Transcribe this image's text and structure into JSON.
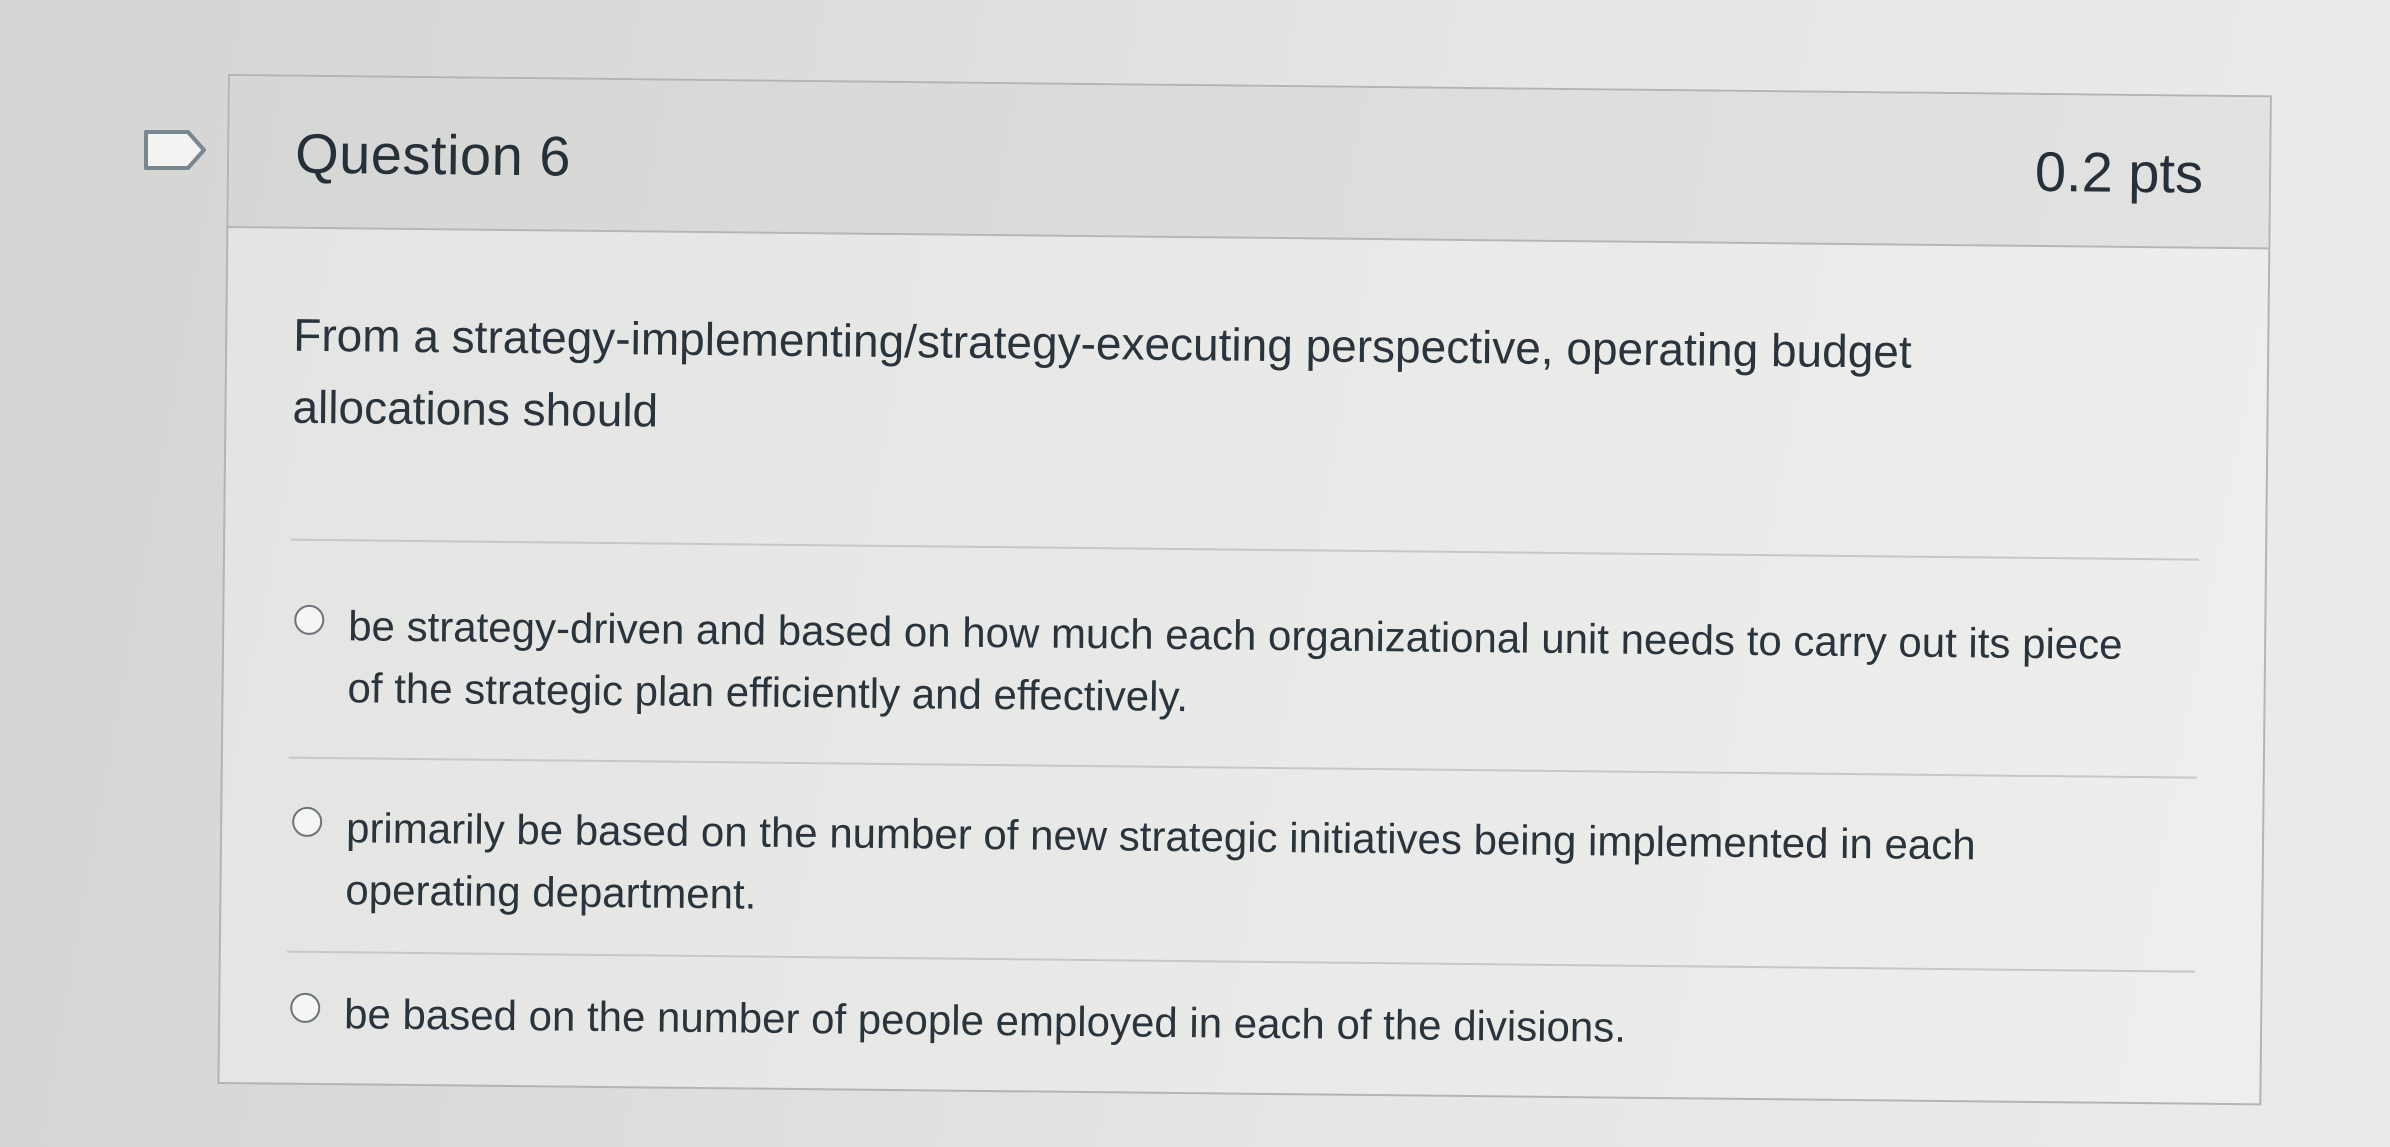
{
  "question": {
    "title": "Question 6",
    "points": "0.2 pts",
    "text": "From a strategy-implementing/strategy-executing perspective, operating budget allocations should",
    "answers": [
      {
        "label": "be strategy-driven and based on how much each organizational unit needs to carry out its piece of the strategic plan efficiently and effectively.",
        "selected": false
      },
      {
        "label": "primarily be based on the number of new strategic initiatives being implemented in each operating department.",
        "selected": false
      },
      {
        "label": "be based on the number of people employed in each of the divisions.",
        "selected": false
      }
    ]
  },
  "icons": {
    "flag": "bookmark-flag-icon",
    "radio": "radio-button-icon"
  },
  "colors": {
    "card_border": "#b4b5b3",
    "header_bg": "#dcdcda",
    "text": "#2a343c"
  }
}
